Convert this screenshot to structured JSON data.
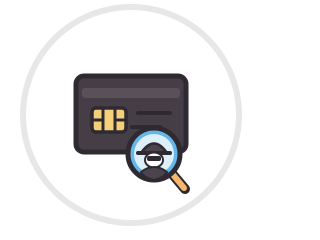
{
  "badge": {
    "icon": "spy-card-inspection-icon",
    "parts": [
      "credit-card-icon",
      "card-chip-icon",
      "magnifying-glass-icon",
      "spy-agent-icon"
    ],
    "colors": {
      "ring": "#e7e7e8",
      "card": "#463e46",
      "card_stripe": "#655d67",
      "chip": "#f4d07a",
      "outline": "#2f2a31",
      "lens": "#64b7e8",
      "handle": "#f5b86d",
      "agent": "#4a444c"
    }
  }
}
